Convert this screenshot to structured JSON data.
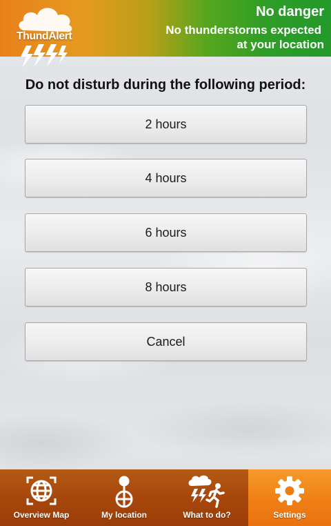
{
  "header": {
    "logo_text": "ThundAlert",
    "status_title": "No danger",
    "status_line1": "No thunderstorms expected",
    "status_line2": "at your location",
    "colors": {
      "orange": "#e8801a",
      "green": "#23992a"
    }
  },
  "dialog": {
    "prompt": "Do not disturb during the following period:",
    "options": [
      {
        "label": "2 hours"
      },
      {
        "label": "4 hours"
      },
      {
        "label": "6 hours"
      },
      {
        "label": "8 hours"
      },
      {
        "label": "Cancel"
      }
    ]
  },
  "nav": {
    "items": [
      {
        "label": "Overview Map",
        "icon": "globe-map-icon"
      },
      {
        "label": "My location",
        "icon": "location-pin-icon"
      },
      {
        "label": "What to do?",
        "icon": "storm-run-icon"
      },
      {
        "label": "Settings",
        "icon": "gear-icon"
      }
    ],
    "active_index": 3,
    "colors": {
      "bar": "#a9480c",
      "active": "#ef7d14"
    }
  }
}
